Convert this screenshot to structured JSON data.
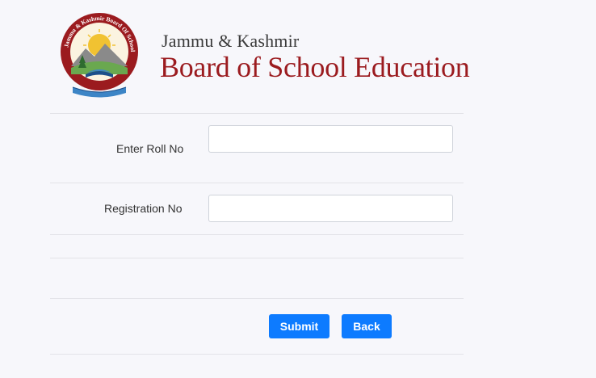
{
  "header": {
    "subtitle": "Jammu & Kashmir",
    "title": "Board of School Education",
    "logo": {
      "ring_text": "Jammu & Kashmir Board Of School Education",
      "colors": {
        "ring": "#9b1b1f",
        "sun": "#f1c232",
        "hills": "#6aa84f",
        "book": "#3d85c6"
      }
    }
  },
  "form": {
    "roll": {
      "label": "Enter Roll No",
      "value": "",
      "placeholder": ""
    },
    "registration": {
      "label": "Registration No",
      "value": "",
      "placeholder": ""
    }
  },
  "actions": {
    "submit_label": "Submit",
    "back_label": "Back"
  },
  "colors": {
    "accent": "#0d7bff",
    "title": "#9b1b1f",
    "background": "#f7f7fb"
  }
}
